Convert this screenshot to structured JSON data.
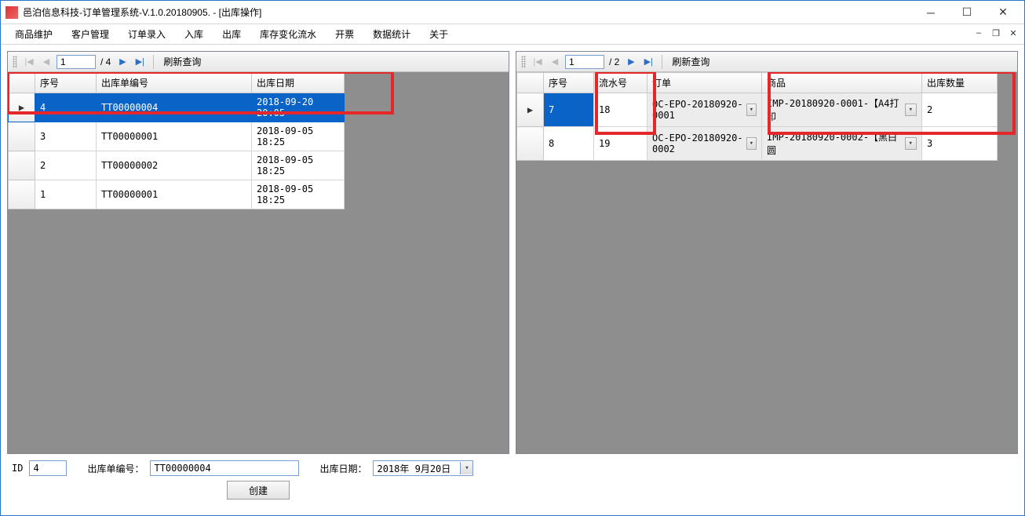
{
  "window": {
    "title": "邑泊信息科技-订单管理系统-V.1.0.20180905. - [出库操作]"
  },
  "menu": {
    "items": [
      "商品维护",
      "客户管理",
      "订单录入",
      "入库",
      "出库",
      "库存变化流水",
      "开票",
      "数据统计",
      "关于"
    ]
  },
  "left_panel": {
    "nav": {
      "current": "1",
      "total": "/ 4",
      "refresh": "刷新查询"
    },
    "columns": {
      "seq": "序号",
      "docno": "出库单编号",
      "date": "出库日期"
    },
    "rows": [
      {
        "seq": "4",
        "docno": "TT00000004",
        "date": "2018-09-20 20:05",
        "selected": true
      },
      {
        "seq": "3",
        "docno": "TT00000001",
        "date": "2018-09-05 18:25",
        "selected": false
      },
      {
        "seq": "2",
        "docno": "TT00000002",
        "date": "2018-09-05 18:25",
        "selected": false
      },
      {
        "seq": "1",
        "docno": "TT00000001",
        "date": "2018-09-05 18:25",
        "selected": false
      }
    ]
  },
  "right_panel": {
    "nav": {
      "current": "1",
      "total": "/ 2",
      "refresh": "刷新查询"
    },
    "columns": {
      "seq": "序号",
      "flow": "流水号",
      "order": "订单",
      "product": "商品",
      "qty": "出库数量"
    },
    "rows": [
      {
        "seq": "7",
        "flow": "18",
        "order": "OC-EPO-20180920-0001",
        "product": "IMP-20180920-0001-【A4打印",
        "qty": "2",
        "selected": true
      },
      {
        "seq": "8",
        "flow": "19",
        "order": "OC-EPO-20180920-0002",
        "product": "IMP-20180920-0002-【黑白圆",
        "qty": "3",
        "selected": false
      }
    ]
  },
  "form": {
    "id_label": "ID",
    "id_value": "4",
    "docno_label": "出库单编号：",
    "docno_value": "TT00000004",
    "date_label": "出库日期：",
    "date_value": "2018年 9月20日",
    "create_button": "创建"
  }
}
